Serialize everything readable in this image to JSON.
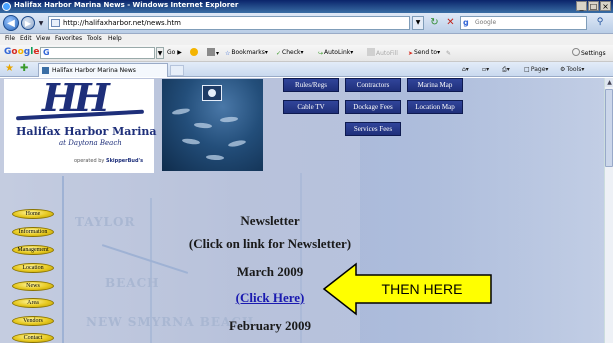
{
  "window": {
    "title": "Halifax Harbor Marina News - Windows Internet Explorer",
    "controls": [
      "_",
      "□",
      "×"
    ]
  },
  "address_bar": {
    "url": "http://halifaxharbor.net/news.htm",
    "search_placeholder": "Google"
  },
  "menu": [
    "File",
    "Edit",
    "View",
    "Favorites",
    "Tools",
    "Help"
  ],
  "google_toolbar": {
    "logo": "Google",
    "search_value": "G",
    "items": [
      "Go",
      "Bookmarks",
      "Check",
      "AutoLink",
      "AutoFill",
      "Send to",
      "Settings"
    ]
  },
  "tab": {
    "title": "Halifax Harbor Marina News"
  },
  "command_bar": [
    "Page",
    "Tools"
  ],
  "site": {
    "logo_letters": "HH",
    "name": "Halifax Harbor Marina",
    "subtitle": "at Daytona Beach",
    "operated_by": "operated by",
    "operator": "SkipperBud's"
  },
  "top_nav": {
    "rules": "Rules/Regs",
    "contractors": "Contractors",
    "marina_map": "Marina Map",
    "cable_tv": "Cable TV",
    "dockage_fees": "Dockage Fees",
    "location_map": "Location Map",
    "services_fees": "Services Fees"
  },
  "side_nav": [
    "Home",
    "Information",
    "Management",
    "Location",
    "News",
    "Area",
    "Vendors",
    "Contact"
  ],
  "map_labels": [
    "TAYLOR",
    "BEACH",
    "NEW SMYRNA BEACH"
  ],
  "content": {
    "heading": "Newsletter",
    "instruction": "(Click on link for Newsletter)",
    "month_1": "March 2009",
    "link": "(Click Here)",
    "month_2": "February 2009"
  },
  "callout": {
    "text": "THEN HERE",
    "fill": "#ffff00",
    "stroke": "#000000"
  },
  "colors": {
    "nav_button": "#1f2f7a",
    "pill": "#e6c81e",
    "link": "#1a1ab0"
  }
}
